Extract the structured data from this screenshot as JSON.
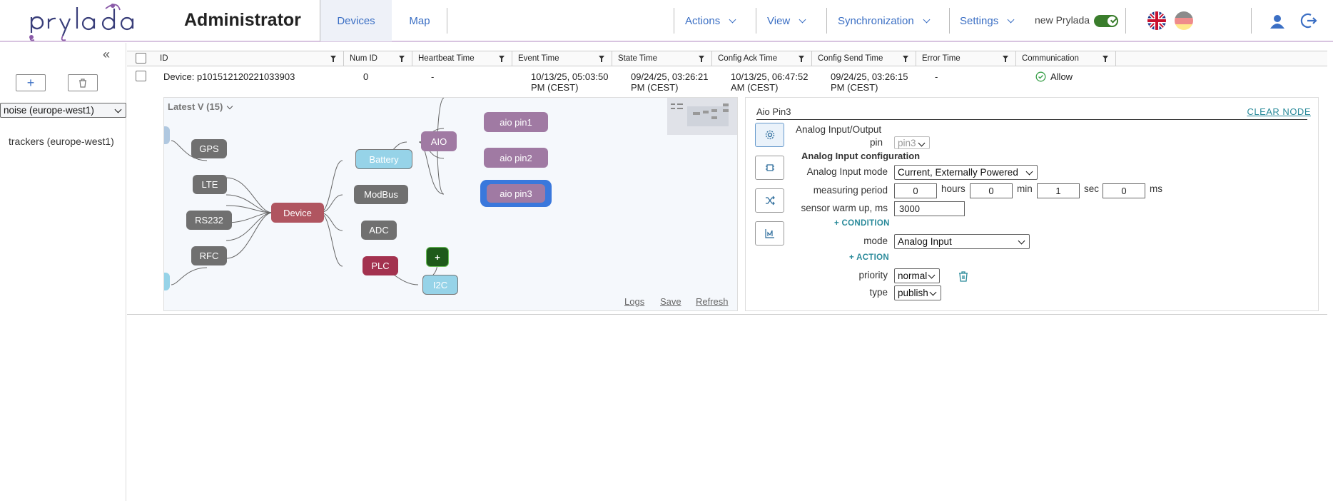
{
  "header": {
    "app_title": "Administrator",
    "tabs": [
      {
        "label": "Devices",
        "active": true
      },
      {
        "label": "Map",
        "active": false
      }
    ],
    "menus": [
      "Actions",
      "View",
      "Synchronization",
      "Settings"
    ],
    "new_prylada_label": "new Prylada",
    "new_prylada_on": true,
    "languages": [
      "en",
      "de"
    ]
  },
  "sidebar": {
    "items": [
      {
        "label": "noise (europe-west1)",
        "selected": true
      },
      {
        "label": "trackers (europe-west1)",
        "selected": false
      }
    ]
  },
  "table": {
    "columns": [
      "ID",
      "Num ID",
      "Heartbeat Time",
      "Event Time",
      "State Time",
      "Config Ack Time",
      "Config Send Time",
      "Error Time",
      "Communication"
    ],
    "row": {
      "id": "Device: p101512120221033903",
      "num_id": "0",
      "heartbeat": "-",
      "event_time_1": "10/13/25, 05:03:50",
      "event_time_2": "PM (CEST)",
      "state_time_1": "09/24/25, 03:26:21",
      "state_time_2": "PM (CEST)",
      "config_ack_1": "10/13/25, 06:47:52",
      "config_ack_2": "AM (CEST)",
      "config_send_1": "09/24/25, 03:26:15",
      "config_send_2": "PM (CEST)",
      "error_time": "-",
      "communication": "Allow"
    }
  },
  "tree": {
    "version_label": "Latest V (15)",
    "nodes": {
      "gps": "GPS",
      "lte": "LTE",
      "rs232": "RS232",
      "rfc": "RFC",
      "device": "Device",
      "battery": "Battery",
      "modbus": "ModBus",
      "adc": "ADC",
      "plc": "PLC",
      "aio": "AIO",
      "aio_pin1": "aio pin1",
      "aio_pin2": "aio pin2",
      "aio_pin3": "aio pin3",
      "i2c": "I2C",
      "plus": "+"
    },
    "links": {
      "logs": "Logs",
      "save": "Save",
      "refresh": "Refresh"
    },
    "colors": {
      "device": "#b05560",
      "aio": "#a07aa3",
      "gray": "#707070",
      "light": "#96d3e8",
      "plc": "#a3324f",
      "green": "#1e5a1a",
      "selected": "#3a78dc"
    }
  },
  "panel": {
    "title": "Aio Pin3",
    "clear_label": "CLEAR NODE",
    "io_label": "Analog Input/Output",
    "pin_label": "pin",
    "pin_value": "pin3",
    "section_title": "Analog Input configuration",
    "mode_label": "Analog Input mode",
    "mode_value": "Current, Externally Powered",
    "period_label": "measuring period",
    "hours_value": "0",
    "hours_unit": "hours",
    "min_value": "0",
    "min_unit": "min",
    "sec_value": "1",
    "sec_unit": "sec",
    "ms_value": "0",
    "ms_unit": "ms",
    "warmup_label": "sensor warm up, ms",
    "warmup_value": "3000",
    "condition_label": "CONDITION",
    "cond_mode_label": "mode",
    "cond_mode_value": "Analog Input",
    "action_label": "ACTION",
    "priority_label": "priority",
    "priority_value": "normal",
    "type_label": "type",
    "type_value": "publish",
    "tab_icons": [
      "gear-icon",
      "chip-icon",
      "shuffle-icon",
      "chart-icon"
    ]
  }
}
